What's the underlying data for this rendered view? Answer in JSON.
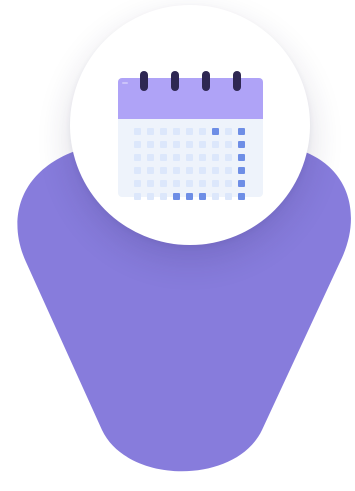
{
  "colors": {
    "background": "#ffffff",
    "shape": "#877CDC",
    "badge": "#ffffff",
    "calendar_header": "#AFA3F7",
    "calendar_rings": "#2E2752",
    "calendar_body": "#EEF3FB",
    "cell_empty": "#DCE7FB",
    "cell_highlight": "#6E8EE6"
  },
  "icons": {
    "badge_icon": "calendar-icon"
  },
  "calendar": {
    "rows": 6,
    "columns": 9,
    "highlighted_cells": [
      [
        0,
        6
      ],
      [
        0,
        8
      ],
      [
        1,
        8
      ],
      [
        2,
        8
      ],
      [
        3,
        8
      ],
      [
        4,
        8
      ],
      [
        5,
        3
      ],
      [
        5,
        4
      ],
      [
        5,
        5
      ],
      [
        5,
        8
      ]
    ]
  }
}
